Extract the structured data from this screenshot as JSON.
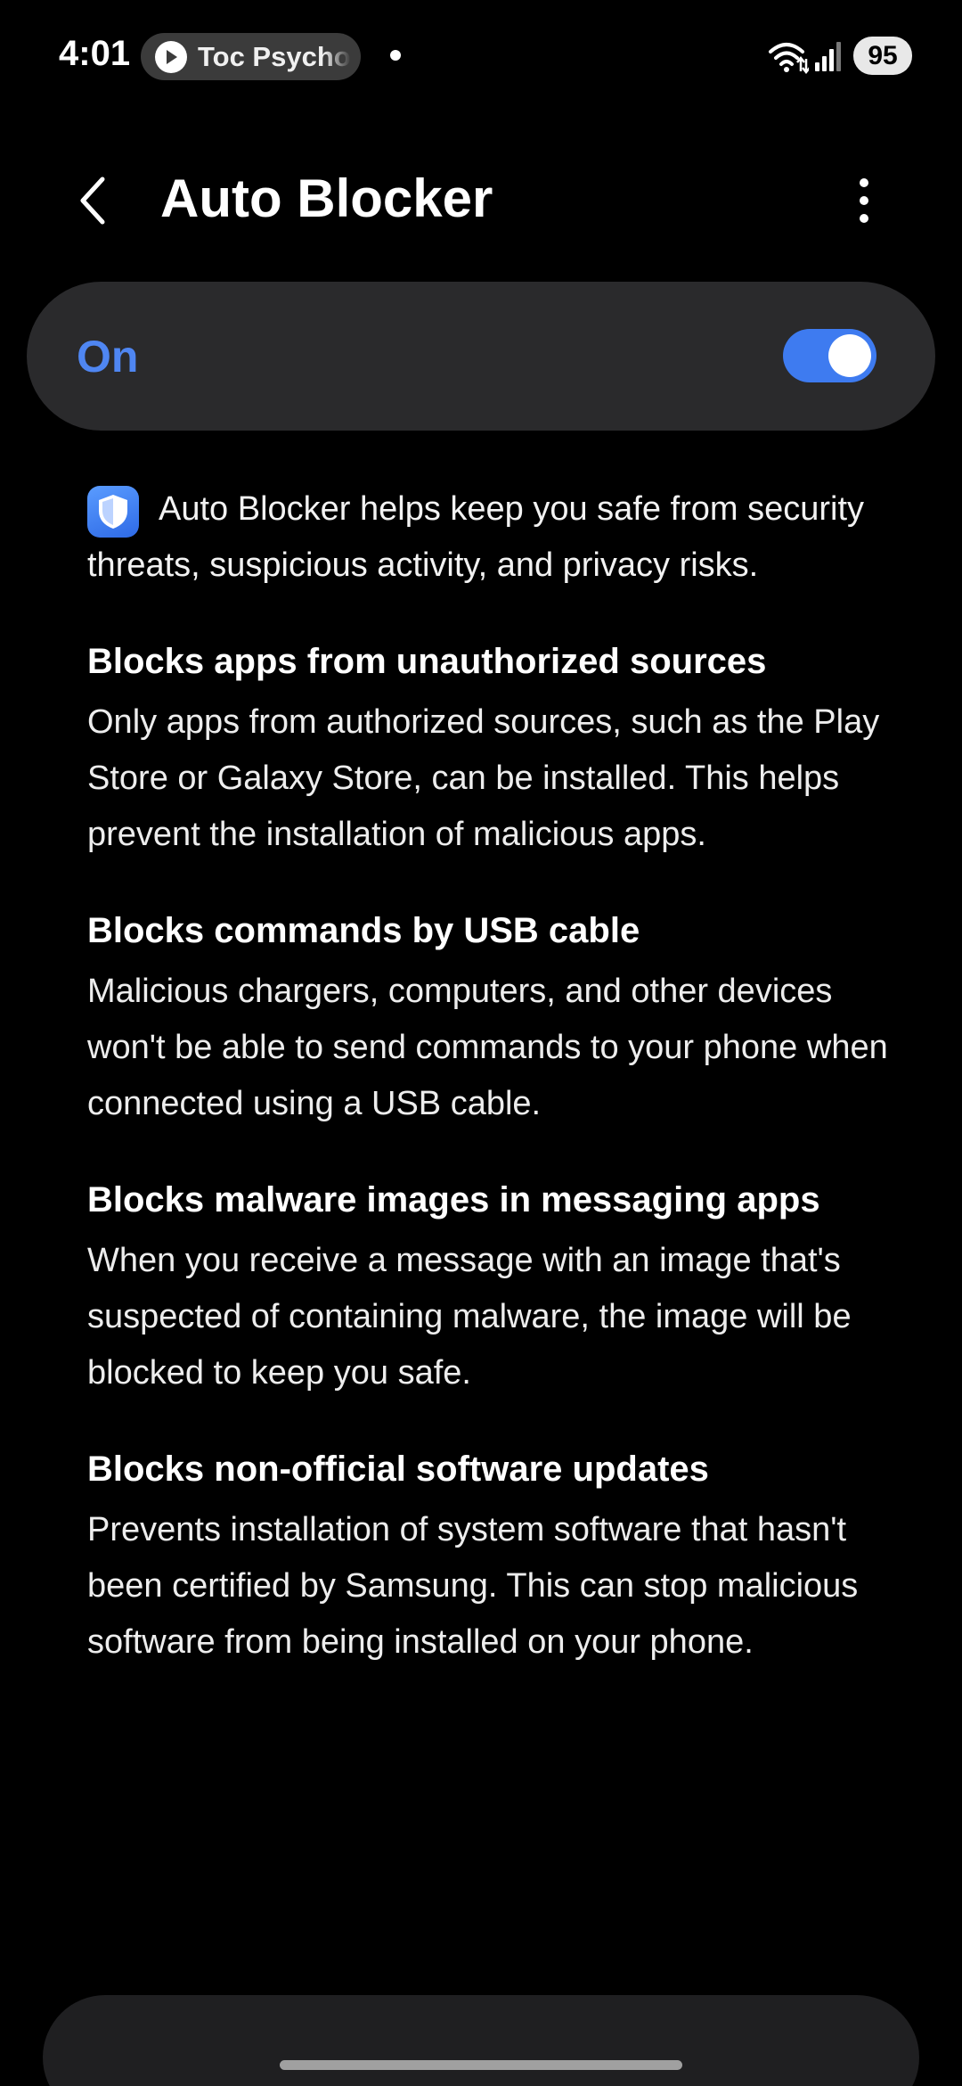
{
  "status_bar": {
    "time": "4:01",
    "media_pill_text": "Toc Psycho",
    "battery_level": "95"
  },
  "app_bar": {
    "title": "Auto Blocker"
  },
  "master_switch": {
    "label": "On",
    "state": true,
    "accent_color": "#3e7bf0"
  },
  "intro_text": "Auto Blocker helps keep you safe from security threats, suspicious activity, and privacy risks.",
  "sections": [
    {
      "title": "Blocks apps from unauthorized sources",
      "body": "Only apps from authorized sources, such as the Play Store or Galaxy Store, can be installed. This helps prevent the installation of malicious apps."
    },
    {
      "title": "Blocks commands by USB cable",
      "body": "Malicious chargers, computers, and other devices won't be able to send commands to your phone when connected using a USB cable."
    },
    {
      "title": "Blocks malware images in messaging apps",
      "body": "When you receive a message with an image that's suspected of containing malware, the image will be blocked to keep you safe."
    },
    {
      "title": "Blocks non-official software updates",
      "body": "Prevents installation of system software that hasn't been certified by Samsung. This can stop malicious software from being installed on your phone."
    }
  ]
}
